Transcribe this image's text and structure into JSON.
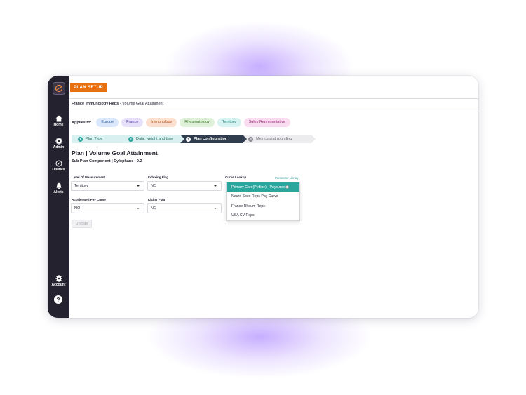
{
  "header": {
    "tab_label": "PLAN SETUP"
  },
  "breadcrumb": {
    "plan": "France Immunology Reps",
    "separator": " - ",
    "page": "Volume Goal Attainment"
  },
  "applies_to": {
    "label": "Applies to:",
    "chips": [
      {
        "label": "Europe",
        "bg": "#dbe8fb",
        "fg": "#2d5ea6"
      },
      {
        "label": "France",
        "bg": "#e7e0fb",
        "fg": "#5b3fb0"
      },
      {
        "label": "Immunology",
        "bg": "#fbdfcf",
        "fg": "#b24a12"
      },
      {
        "label": "Rheumatology",
        "bg": "#dff1d8",
        "fg": "#3d7a2a"
      },
      {
        "label": "Territory",
        "bg": "#d6f3f1",
        "fg": "#2a8a84"
      },
      {
        "label": "Sales Representative",
        "bg": "#fadcf0",
        "fg": "#a12d7c"
      }
    ]
  },
  "steps": [
    {
      "num": "1",
      "label": "Plan Type",
      "state": "done"
    },
    {
      "num": "2",
      "label": "Data, weight and time",
      "state": "done"
    },
    {
      "num": "3",
      "label": "Plan configuration",
      "state": "active"
    },
    {
      "num": "4",
      "label": "Metrics and rounding",
      "state": "todo"
    }
  ],
  "main": {
    "title": "Plan | Volume Goal Attainment",
    "subtitle": "Sub Plan Component | Cylophane | 0.2"
  },
  "form": {
    "level_of_measurement": {
      "label": "Level Of Measurement",
      "value": "Territory"
    },
    "indexing_flag": {
      "label": "Indexing Flag",
      "value": "NO"
    },
    "curve_lookup": {
      "label": "Curve Lookup",
      "link": "Parameter Library"
    },
    "accelerated_pay_curve": {
      "label": "Accelerated Pay Curve",
      "value": "NO"
    },
    "kicker_flag": {
      "label": "Kicker Flag",
      "value": "NO"
    },
    "update_label": "Update"
  },
  "dropdown": {
    "options": [
      "Primary Care(Pydine) - Paycurve",
      "Neuro Spec Reps Pay Curve",
      "France Rheum Reps",
      "USA CV Reps"
    ],
    "selected_index": 0
  },
  "sidebar": {
    "items": [
      {
        "label": "Home",
        "icon": "home-icon"
      },
      {
        "label": "Admin",
        "icon": "gear-icon"
      },
      {
        "label": "Utilities",
        "icon": "link-icon"
      },
      {
        "label": "Alerts",
        "icon": "bell-icon"
      },
      {
        "label": "Account",
        "icon": "gear-icon"
      }
    ],
    "help_label": "?"
  },
  "colors": {
    "accent": "#e8700f",
    "teal": "#2aa69d",
    "sidebar": "#25222f",
    "active_step": "#2f3d4f"
  }
}
